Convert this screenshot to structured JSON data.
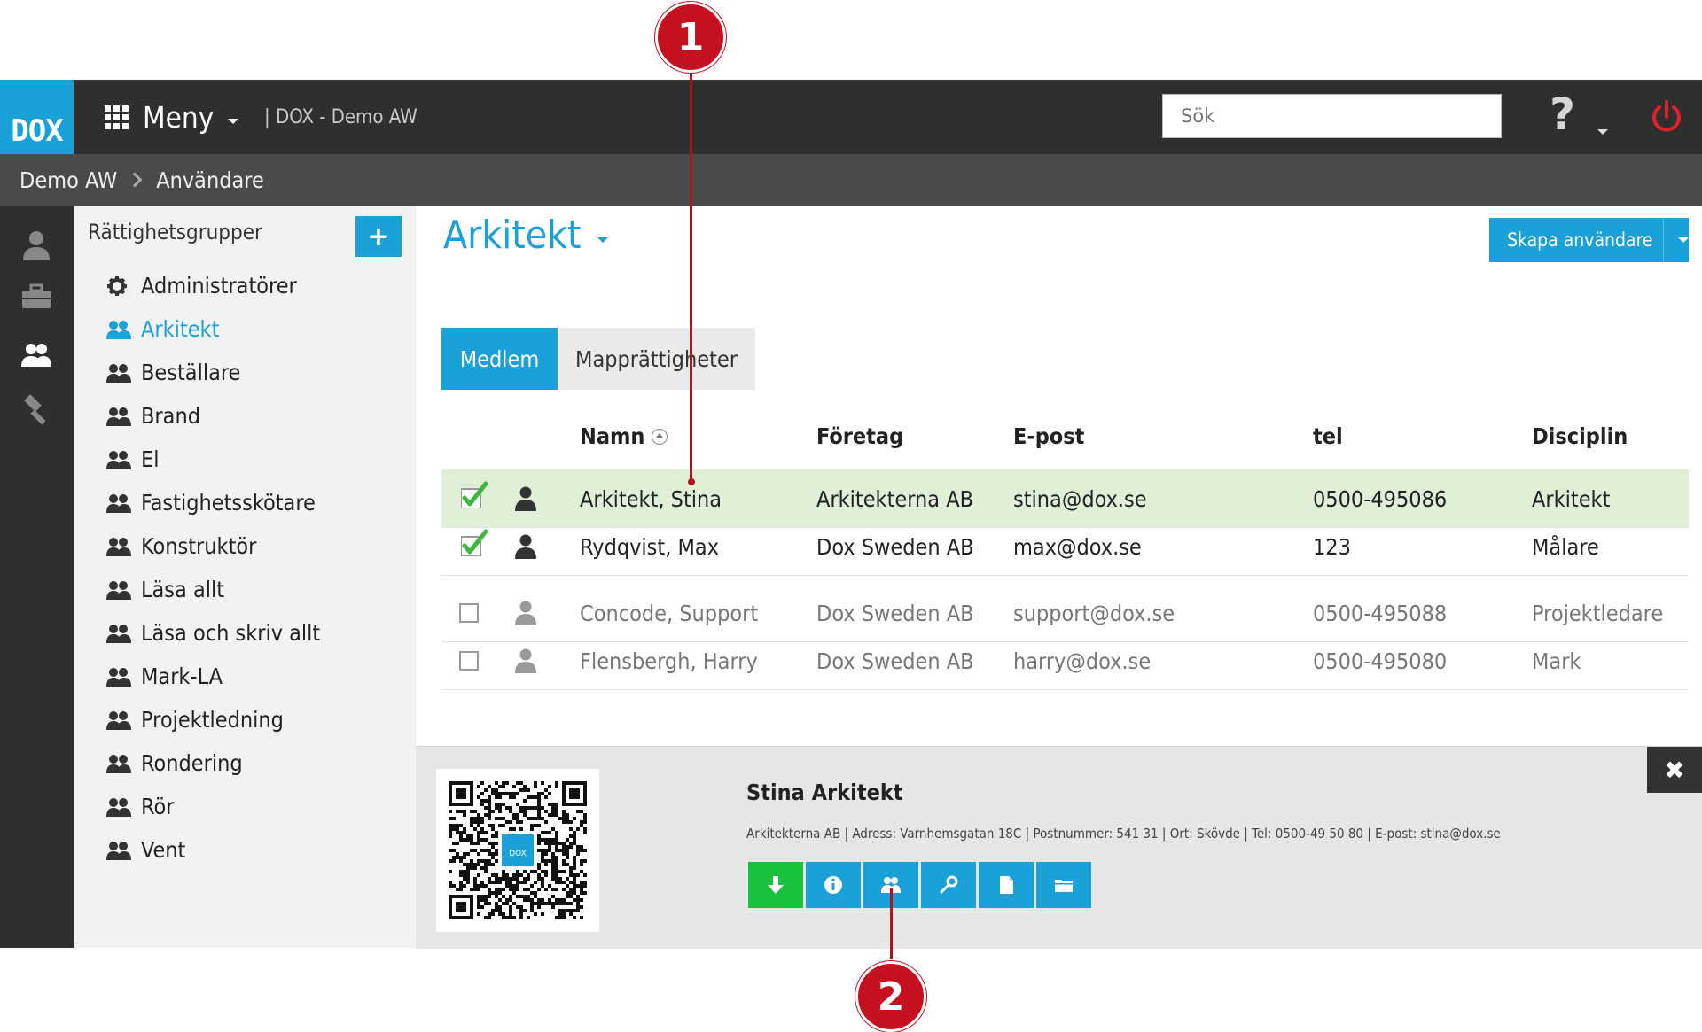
{
  "app": {
    "logo": "DOX",
    "menu_label": "Meny",
    "context": "| DOX - Demo AW",
    "search_placeholder": "Sök",
    "help_label": "?"
  },
  "breadcrumb": [
    "Demo AW",
    "Användare"
  ],
  "rail": [
    "user-icon",
    "briefcase-icon",
    "users-icon",
    "hammer-icon"
  ],
  "groups": {
    "title": "Rättighetsgrupper",
    "add_label": "+",
    "items": [
      {
        "label": "Administratörer",
        "icon": "gear-icon",
        "active": false
      },
      {
        "label": "Arkitekt",
        "icon": "users-icon",
        "active": true
      },
      {
        "label": "Beställare",
        "icon": "users-icon",
        "active": false
      },
      {
        "label": "Brand",
        "icon": "users-icon",
        "active": false
      },
      {
        "label": "El",
        "icon": "users-icon",
        "active": false
      },
      {
        "label": "Fastighetsskötare",
        "icon": "users-icon",
        "active": false
      },
      {
        "label": "Konstruktör",
        "icon": "users-icon",
        "active": false
      },
      {
        "label": "Läsa allt",
        "icon": "users-icon",
        "active": false
      },
      {
        "label": "Läsa och skriv allt",
        "icon": "users-icon",
        "active": false
      },
      {
        "label": "Mark-LA",
        "icon": "users-icon",
        "active": false
      },
      {
        "label": "Projektledning",
        "icon": "users-icon",
        "active": false
      },
      {
        "label": "Rondering",
        "icon": "users-icon",
        "active": false
      },
      {
        "label": "Rör",
        "icon": "users-icon",
        "active": false
      },
      {
        "label": "Vent",
        "icon": "users-icon",
        "active": false
      }
    ]
  },
  "main": {
    "title": "Arkitekt",
    "create_label": "Skapa användare",
    "tabs": [
      "Medlem",
      "Mapprättigheter"
    ],
    "columns": [
      "Namn",
      "Företag",
      "E-post",
      "tel",
      "Disciplin"
    ],
    "rows": [
      {
        "name": "Arkitekt, Stina",
        "company": "Arkitekterna AB",
        "email": "stina@dox.se",
        "tel": "0500-495086",
        "discipline": "Arkitekt",
        "checked": true,
        "selected": true
      },
      {
        "name": "Rydqvist, Max",
        "company": "Dox Sweden AB",
        "email": "max@dox.se",
        "tel": "123",
        "discipline": "Målare",
        "checked": true,
        "selected": false
      },
      {
        "name": "Concode, Support",
        "company": "Dox Sweden AB",
        "email": "support@dox.se",
        "tel": "0500-495088",
        "discipline": "Projektledare",
        "checked": false,
        "selected": false
      },
      {
        "name": "Flensbergh, Harry",
        "company": "Dox Sweden AB",
        "email": "harry@dox.se",
        "tel": "0500-495080",
        "discipline": "Mark",
        "checked": false,
        "selected": false
      }
    ]
  },
  "detail": {
    "name": "Stina Arkitekt",
    "info": "Arkitekterna AB | Adress: Varnhemsgatan 18C | Postnummer: 541 31 | Ort: Skövde | Tel: 0500-49 50 80 | E-post: stina@dox.se",
    "qr_label": "DOX",
    "close_label": "✖",
    "actions": [
      "download-icon",
      "info-icon",
      "users-icon",
      "key-icon",
      "document-icon",
      "folder-icon"
    ]
  },
  "callouts": [
    "1",
    "2"
  ],
  "colors": {
    "accent": "#1aa1d8",
    "bar": "#2f2f2f",
    "selected_row": "#dff0d6",
    "callout": "#c4101f",
    "download": "#18c23c"
  }
}
